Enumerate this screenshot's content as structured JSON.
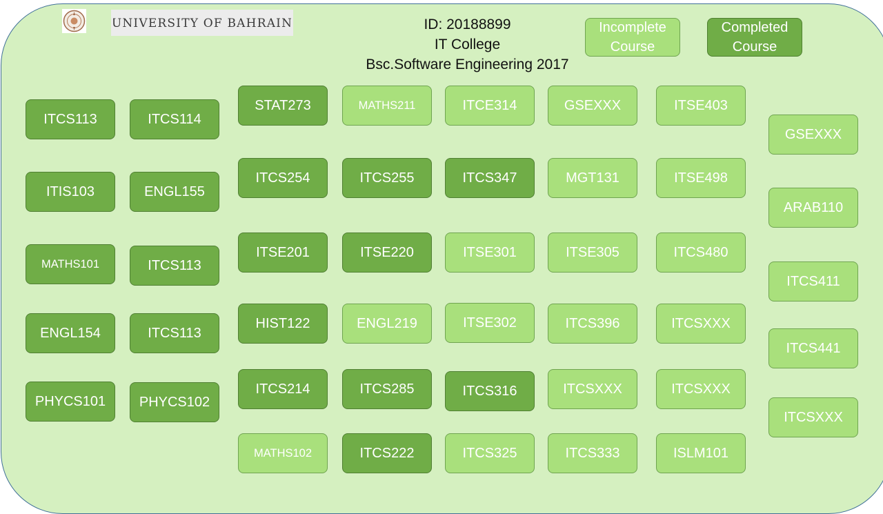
{
  "header": {
    "logo_text": "University of Bahrain",
    "id_line": "ID: 20188899",
    "college": "IT College",
    "program": "Bsc.Software Engineering 2017"
  },
  "legend": {
    "incomplete_line1": "Incomplete",
    "incomplete_line2": "Course",
    "completed_line1": "Completed",
    "completed_line2": "Course"
  },
  "colors": {
    "completed": "#70ad47",
    "incomplete": "#a9e07c",
    "background": "#d5f0c0"
  },
  "courses": [
    {
      "code": "ITCS113",
      "status": "completed"
    },
    {
      "code": "ITCS114",
      "status": "completed"
    },
    {
      "code": "ITIS103",
      "status": "completed"
    },
    {
      "code": "ENGL155",
      "status": "completed"
    },
    {
      "code": "MATHS101",
      "status": "completed"
    },
    {
      "code": "ITCS113",
      "status": "completed"
    },
    {
      "code": "ENGL154",
      "status": "completed"
    },
    {
      "code": "ITCS113",
      "status": "completed"
    },
    {
      "code": "PHYCS101",
      "status": "completed"
    },
    {
      "code": "PHYCS102",
      "status": "completed"
    },
    {
      "code": "STAT273",
      "status": "completed"
    },
    {
      "code": "MATHS211",
      "status": "incomplete"
    },
    {
      "code": "ITCE314",
      "status": "incomplete"
    },
    {
      "code": "GSEXXX",
      "status": "incomplete"
    },
    {
      "code": "ITSE403",
      "status": "incomplete"
    },
    {
      "code": "ITCS254",
      "status": "completed"
    },
    {
      "code": "ITCS255",
      "status": "completed"
    },
    {
      "code": "ITCS347",
      "status": "completed"
    },
    {
      "code": "MGT131",
      "status": "incomplete"
    },
    {
      "code": "ITSE498",
      "status": "incomplete"
    },
    {
      "code": "ITSE201",
      "status": "completed"
    },
    {
      "code": "ITSE220",
      "status": "completed"
    },
    {
      "code": "ITSE301",
      "status": "incomplete"
    },
    {
      "code": "ITSE305",
      "status": "incomplete"
    },
    {
      "code": "ITCS480",
      "status": "incomplete"
    },
    {
      "code": "HIST122",
      "status": "completed"
    },
    {
      "code": "ENGL219",
      "status": "incomplete"
    },
    {
      "code": "ITSE302",
      "status": "incomplete"
    },
    {
      "code": "ITCS396",
      "status": "incomplete"
    },
    {
      "code": "ITCSXXX",
      "status": "incomplete"
    },
    {
      "code": "ITCS214",
      "status": "completed"
    },
    {
      "code": "ITCS285",
      "status": "completed"
    },
    {
      "code": "ITCS316",
      "status": "completed"
    },
    {
      "code": "ITCSXXX",
      "status": "incomplete"
    },
    {
      "code": "ITCSXXX",
      "status": "incomplete"
    },
    {
      "code": "MATHS102",
      "status": "incomplete"
    },
    {
      "code": "ITCS222",
      "status": "completed"
    },
    {
      "code": "ITCS325",
      "status": "incomplete"
    },
    {
      "code": "ITCS333",
      "status": "incomplete"
    },
    {
      "code": "ISLM101",
      "status": "incomplete"
    },
    {
      "code": "GSEXXX",
      "status": "incomplete"
    },
    {
      "code": "ARAB110",
      "status": "incomplete"
    },
    {
      "code": "ITCS411",
      "status": "incomplete"
    },
    {
      "code": "ITCS441",
      "status": "incomplete"
    },
    {
      "code": "ITCSXXX",
      "status": "incomplete"
    }
  ]
}
